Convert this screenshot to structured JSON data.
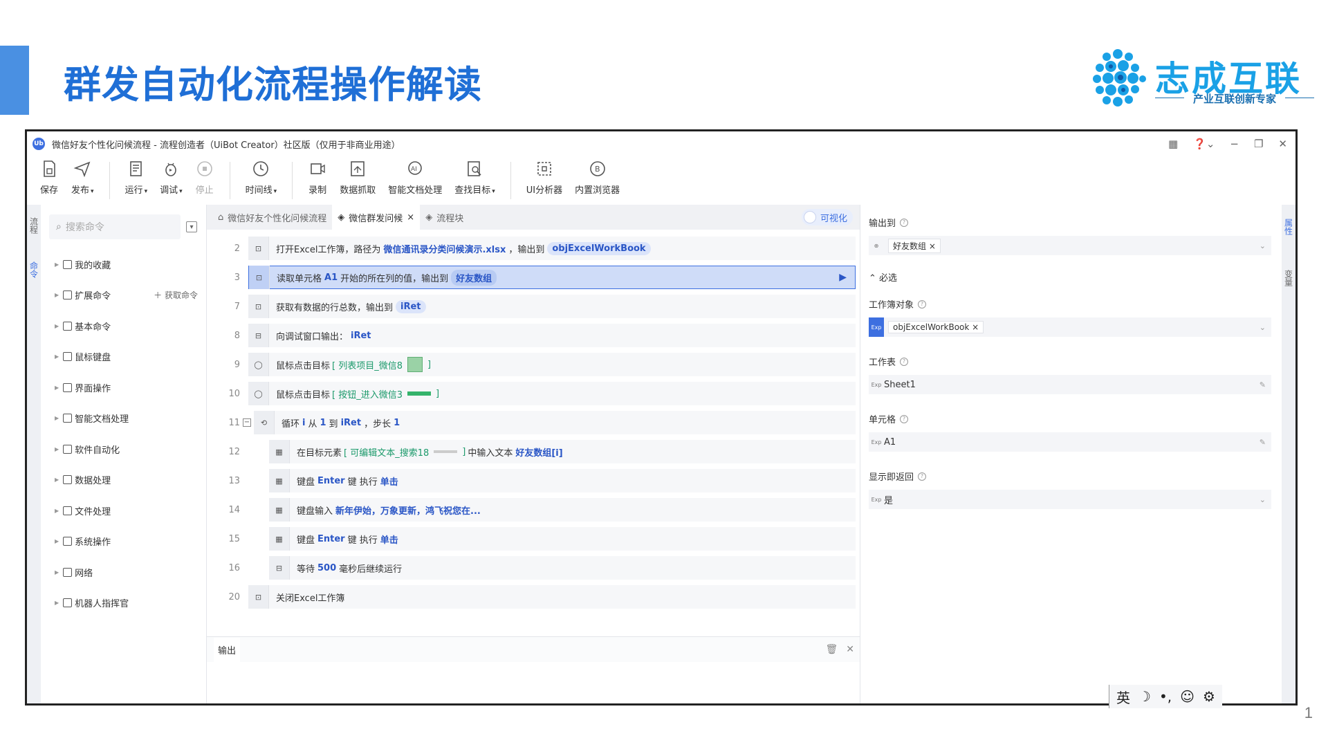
{
  "slide": {
    "title": "群发自动化流程操作解读",
    "page_number": "1",
    "logo": {
      "name": "志成互联",
      "tagline": "产业互联创新专家"
    }
  },
  "window": {
    "app_badge": "Ub",
    "title": "微信好友个性化问候流程 - 流程创造者（UiBot Creator）社区版（仅用于非商业用途）"
  },
  "toolbar": {
    "tools": [
      {
        "label": "保存",
        "icon": "save-icon",
        "caret": false,
        "disabled": false
      },
      {
        "label": "发布",
        "icon": "send-icon",
        "caret": true,
        "disabled": false
      },
      {
        "label": "运行",
        "icon": "run-icon",
        "caret": true,
        "disabled": false
      },
      {
        "label": "调试",
        "icon": "debug-icon",
        "caret": true,
        "disabled": false
      },
      {
        "label": "停止",
        "icon": "stop-icon",
        "caret": false,
        "disabled": true
      },
      {
        "label": "时间线",
        "icon": "clock-icon",
        "caret": true,
        "disabled": false
      },
      {
        "label": "录制",
        "icon": "record-icon",
        "caret": false,
        "disabled": false
      },
      {
        "label": "数据抓取",
        "icon": "data-capture-icon",
        "caret": false,
        "disabled": false
      },
      {
        "label": "智能文档处理",
        "icon": "ai-doc-icon",
        "caret": false,
        "disabled": false
      },
      {
        "label": "查找目标",
        "icon": "find-target-icon",
        "caret": true,
        "disabled": false
      },
      {
        "label": "UI分析器",
        "icon": "ui-analyzer-icon",
        "caret": false,
        "disabled": false
      },
      {
        "label": "内置浏览器",
        "icon": "browser-icon",
        "caret": false,
        "disabled": false
      }
    ]
  },
  "left_tabs": [
    "流程",
    "命令"
  ],
  "commands": {
    "search_placeholder": "搜索命令",
    "categories": [
      {
        "label": "我的收藏",
        "extra": ""
      },
      {
        "label": "扩展命令",
        "extra": "＋ 获取命令"
      },
      {
        "label": "基本命令",
        "extra": ""
      },
      {
        "label": "鼠标键盘",
        "extra": ""
      },
      {
        "label": "界面操作",
        "extra": ""
      },
      {
        "label": "智能文档处理",
        "extra": ""
      },
      {
        "label": "软件自动化",
        "extra": ""
      },
      {
        "label": "数据处理",
        "extra": ""
      },
      {
        "label": "文件处理",
        "extra": ""
      },
      {
        "label": "系统操作",
        "extra": ""
      },
      {
        "label": "网络",
        "extra": ""
      },
      {
        "label": "机器人指挥官",
        "extra": ""
      }
    ]
  },
  "tabs": [
    {
      "label": "微信好友个性化问候流程",
      "closable": false
    },
    {
      "label": "微信群发问候",
      "closable": true
    },
    {
      "label": "流程块",
      "closable": false
    }
  ],
  "visualize_label": "可视化",
  "steps": {
    "s2": {
      "no": "2",
      "pre": "打开Excel工作簿，路径为",
      "path": "微信通讯录分类问候演示.xlsx",
      "mid": "，输出到",
      "var": "objExcelWorkBook"
    },
    "s3": {
      "no": "3",
      "pre": "读取单元格",
      "cell": "A1",
      "mid": "开始的所在列的值，输出到",
      "var": "好友数组"
    },
    "s7": {
      "no": "7",
      "pre": "获取有数据的行总数，输出到",
      "var": "iRet"
    },
    "s8": {
      "no": "8",
      "pre": "向调试窗口输出：",
      "var": "iRet"
    },
    "s9": {
      "no": "9",
      "pre": "鼠标点击目标",
      "target": "[ 列表项目_微信8",
      "close": "]"
    },
    "s10": {
      "no": "10",
      "pre": "鼠标点击目标",
      "target": "[ 按钮_进入微信3",
      "close": "]"
    },
    "s11": {
      "no": "11",
      "pre": "循环",
      "i": "i",
      "from": "从",
      "start": "1",
      "to": "到",
      "end": "iRet",
      "step": "，步长",
      "stepv": "1",
      "collapse": "−"
    },
    "s12": {
      "no": "12",
      "pre": "在目标元素",
      "target": "[ 可编辑文本_搜索18",
      "close": "]",
      "mid": "中输入文本",
      "var": "好友数组[i]"
    },
    "s13": {
      "no": "13",
      "pre": "键盘",
      "key": "Enter",
      "mid": "键 执行",
      "action": "单击"
    },
    "s14": {
      "no": "14",
      "pre": "键盘输入",
      "text": "新年伊始，万象更新，鸿飞祝您在..."
    },
    "s15": {
      "no": "15",
      "pre": "键盘",
      "key": "Enter",
      "mid": "键 执行",
      "action": "单击"
    },
    "s16": {
      "no": "16",
      "pre": "等待",
      "ms": "500",
      "mid": "毫秒后继续运行"
    },
    "s20": {
      "no": "20",
      "pre": "关闭Excel工作簿"
    }
  },
  "output": {
    "tab": "输出"
  },
  "properties": {
    "output_to": {
      "label": "输出到",
      "value": "好友数组"
    },
    "required_section": "必选",
    "workbook": {
      "label": "工作簿对象",
      "value": "objExcelWorkBook"
    },
    "sheet": {
      "label": "工作表",
      "value": "Sheet1"
    },
    "cell": {
      "label": "单元格",
      "value": "A1"
    },
    "return_on_show": {
      "label": "显示即返回",
      "value": "是"
    },
    "exp_badge": "Exp"
  },
  "right_tabs": [
    "属性",
    "变量"
  ],
  "ime": {
    "lang": "英",
    "moon": "☽",
    "punct": "•,",
    "emoji": "☺",
    "gear": "⚙"
  },
  "colors": {
    "accent": "#3d6fe0",
    "title": "#1f6fd6",
    "target_green": "#1c9a6b"
  }
}
